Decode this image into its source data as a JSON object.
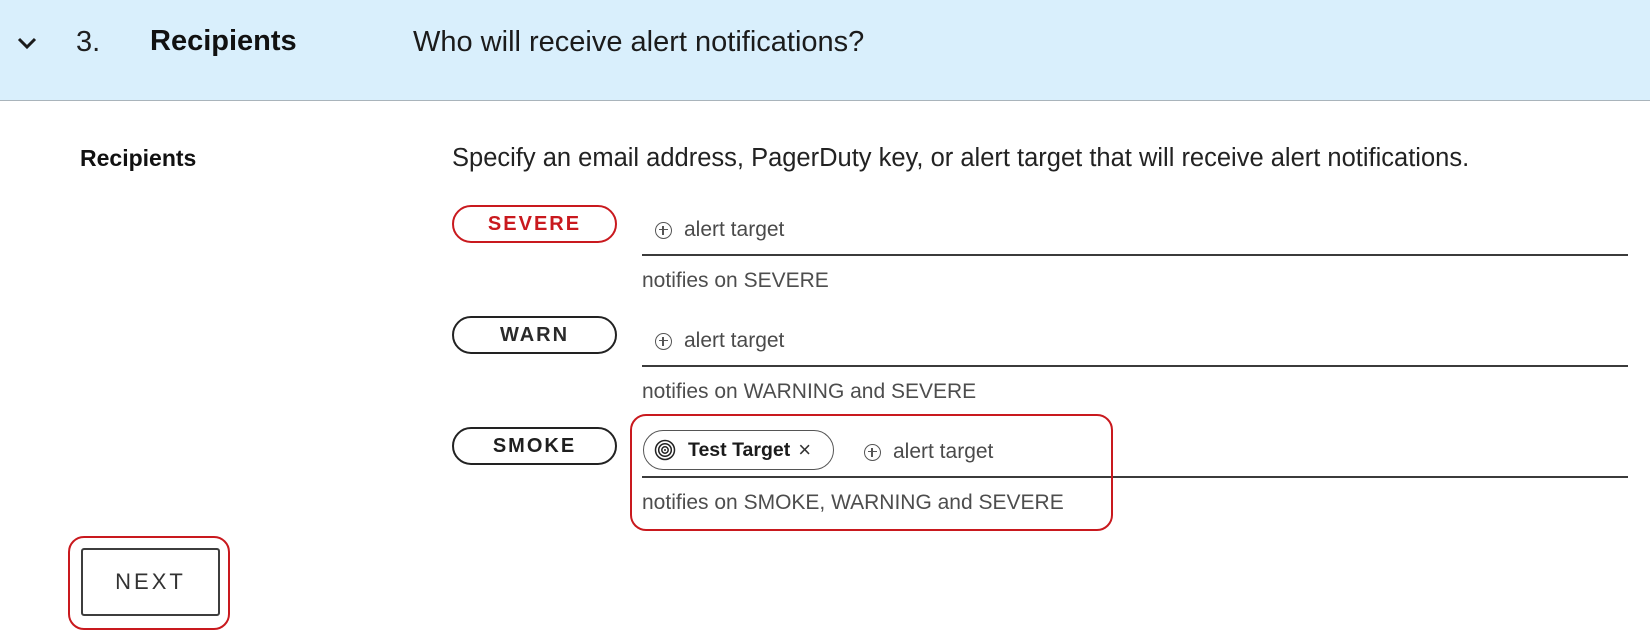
{
  "header": {
    "step_number": "3.",
    "step_title": "Recipients",
    "question": "Who will receive alert notifications?",
    "toggle_icon": "chevron-down-icon",
    "background": "#d9effc"
  },
  "section": {
    "label": "Recipients",
    "instructions": "Specify an email address, PagerDuty key, or alert target that will receive alert notifications."
  },
  "severities": [
    {
      "label": "SEVERE",
      "add_label": "alert target",
      "hint": "notifies on SEVERE",
      "color": "#c9191e"
    },
    {
      "label": "WARN",
      "add_label": "alert target",
      "hint": "notifies on WARNING and SEVERE",
      "color": "#2a2a2a"
    },
    {
      "label": "SMOKE",
      "add_label": "alert target",
      "hint": "notifies on SMOKE, WARNING and SEVERE",
      "color": "#1f1f1f",
      "chips": [
        {
          "label": "Test Target",
          "icon": "target-icon",
          "remove_icon": "close-icon"
        }
      ]
    }
  ],
  "actions": {
    "next_label": "NEXT"
  },
  "highlight_color": "#c9191e"
}
